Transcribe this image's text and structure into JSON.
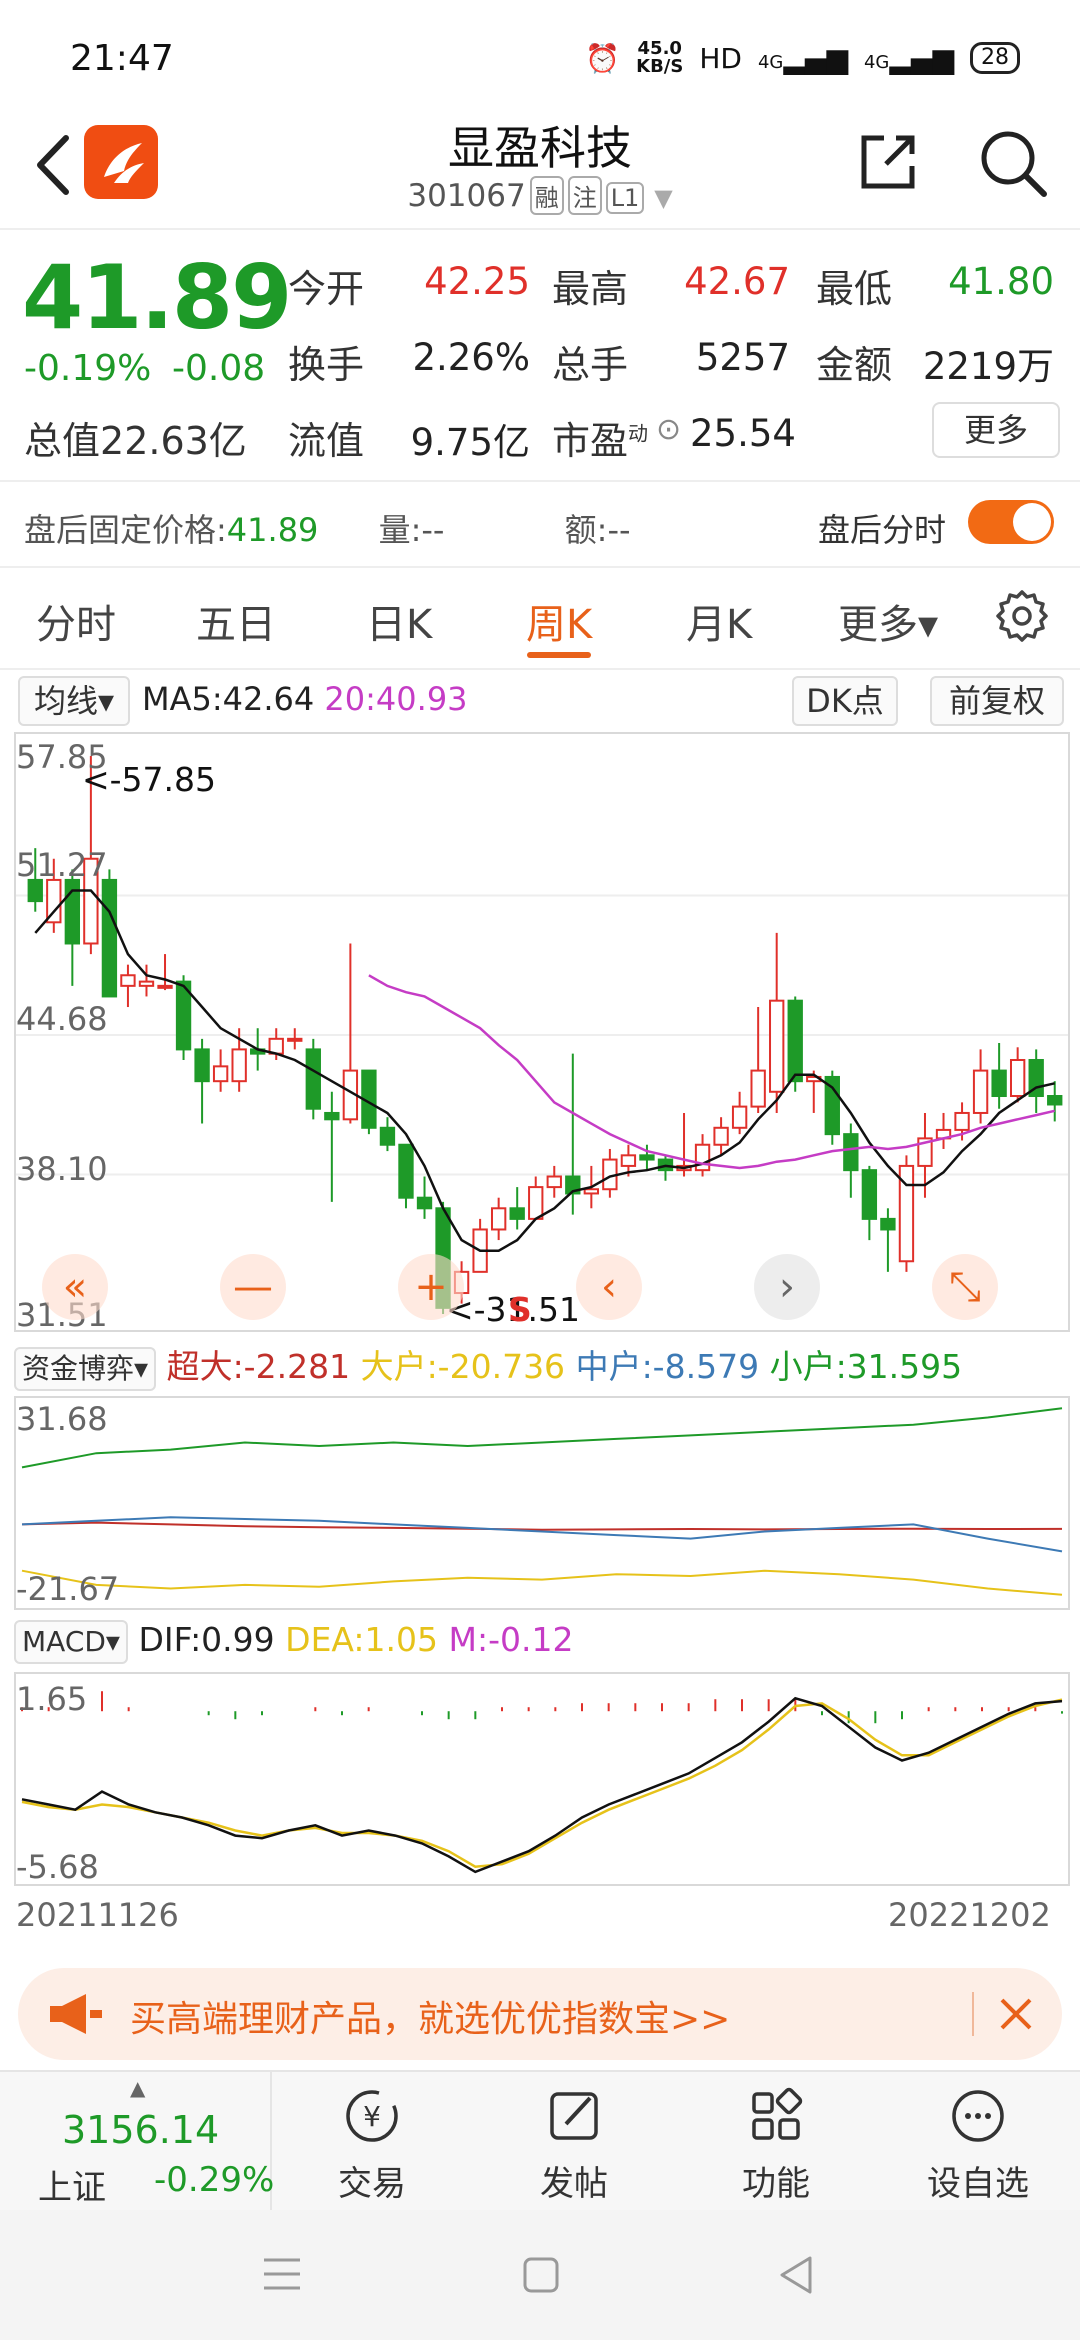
{
  "status": {
    "time": "21:47",
    "net_speed": "45.0",
    "net_unit": "KB/S",
    "hd": "HD",
    "sig1": "4G",
    "sig2": "4G",
    "battery": "28"
  },
  "header": {
    "title": "显盈科技",
    "code": "301067",
    "tags": [
      "融",
      "注",
      "L1"
    ]
  },
  "quote": {
    "price": "41.89",
    "change_pct": "-0.19%",
    "change_abs": "-0.08",
    "open_label": "今开",
    "open": "42.25",
    "high_label": "最高",
    "high": "42.67",
    "low_label": "最低",
    "low": "41.80",
    "turnover_label": "换手",
    "turnover": "2.26%",
    "volume_label": "总手",
    "volume": "5257",
    "amount_label": "金额",
    "amount": "2219万",
    "total_label": "总值",
    "total": "22.63亿",
    "float_label": "流值",
    "float": "9.75亿",
    "pe_label": "市盈",
    "pe_sup": "动",
    "pe": "25.54",
    "more": "更多"
  },
  "after_hours": {
    "label": "盘后固定价格:",
    "price": "41.89",
    "vol_label": "量:",
    "vol": "--",
    "amt_label": "额:",
    "amt": "--",
    "timeshare": "盘后分时"
  },
  "tabs": [
    "分时",
    "五日",
    "日K",
    "周K",
    "月K",
    "更多▾"
  ],
  "ma": {
    "selector": "均线▾",
    "ma5": "MA5:42.64",
    "ma20": "20:40.93",
    "dk": "DK点",
    "fq": "前复权"
  },
  "kline": {
    "y_labels": [
      "57.85",
      "51.27",
      "44.68",
      "38.10",
      "31.51"
    ],
    "max_annot": "<-57.85",
    "min_annot": "<-31.51",
    "s_marker": "S",
    "controls": [
      "«",
      "—",
      "+",
      "‹",
      "›",
      "⤡"
    ]
  },
  "fund": {
    "selector": "资金博弈▾",
    "super": "超大:-2.281",
    "big": "大户:-20.736",
    "mid": "中户:-8.579",
    "small": "小户:31.595",
    "y_top": "31.68",
    "y_bottom": "-21.67"
  },
  "macd": {
    "selector": "MACD▾",
    "dif": "DIF:0.99",
    "dea": "DEA:1.05",
    "m": "M:-0.12",
    "y_top": "1.65",
    "y_bottom": "-5.68"
  },
  "dates": {
    "start": "20211126",
    "end": "20221202"
  },
  "ad": {
    "text": "买高端理财产品，就选优优指数宝>>"
  },
  "bottom": {
    "index_value": "3156.14",
    "index_name": "上证",
    "index_change": "-0.29%",
    "items": [
      "交易",
      "发帖",
      "功能",
      "设自选"
    ]
  },
  "colors": {
    "red": "#e0302a",
    "green": "#1e9a28",
    "accent": "#e8611a",
    "yellow": "#e6c21a",
    "blue": "#3d7ab5",
    "magenta": "#c53cc5"
  },
  "chart_data": {
    "type": "candlestick",
    "x_range": [
      "20211126",
      "20221202"
    ],
    "ylim": [
      31.51,
      57.85
    ],
    "candles": [
      [
        52,
        51,
        53.5,
        50.5
      ],
      [
        50,
        52,
        53,
        49.5
      ],
      [
        52,
        49,
        52.5,
        47
      ],
      [
        49,
        53,
        57.85,
        48.5
      ],
      [
        52,
        46.5,
        52.5,
        46.5
      ],
      [
        47,
        47.5,
        48,
        46
      ],
      [
        47,
        47.2,
        48,
        46.5
      ],
      [
        47,
        47,
        48.5,
        46.8
      ],
      [
        47.2,
        44,
        47.5,
        43.5
      ],
      [
        44,
        42.5,
        44.5,
        40.5
      ],
      [
        42.5,
        43.2,
        44,
        42
      ],
      [
        42.5,
        44,
        45,
        42
      ],
      [
        44,
        43.8,
        45,
        43
      ],
      [
        43.8,
        44.5,
        45,
        43.5
      ],
      [
        44.5,
        44.5,
        45,
        44
      ],
      [
        44,
        41.2,
        44.5,
        40.7
      ],
      [
        41,
        40.7,
        42,
        36.8
      ],
      [
        40.7,
        43,
        49,
        40.5
      ],
      [
        43,
        40.3,
        43,
        40
      ],
      [
        40.3,
        39.5,
        40.8,
        39.2
      ],
      [
        39.5,
        37,
        39.5,
        36.5
      ],
      [
        37,
        36.5,
        38,
        36
      ],
      [
        36.5,
        31.8,
        36.8,
        31.51
      ],
      [
        32.5,
        33.5,
        34,
        32
      ],
      [
        33.5,
        35.5,
        36,
        33.5
      ],
      [
        35.5,
        36.5,
        37,
        35
      ],
      [
        36.5,
        36,
        37.5,
        35.5
      ],
      [
        36,
        37.5,
        38,
        36
      ],
      [
        37.5,
        38,
        38.5,
        37
      ],
      [
        38,
        37.2,
        43.8,
        36.2
      ],
      [
        37.2,
        37.4,
        38.5,
        36.5
      ],
      [
        37.4,
        38.8,
        39.3,
        37
      ],
      [
        38.5,
        39,
        39.5,
        38
      ],
      [
        39,
        38.8,
        39.5,
        38.3
      ],
      [
        38.8,
        38.3,
        39,
        37.8
      ],
      [
        38.3,
        38.5,
        41,
        38
      ],
      [
        38.3,
        39.5,
        40,
        38
      ],
      [
        39.5,
        40.3,
        40.8,
        39
      ],
      [
        40.3,
        41.3,
        42,
        40
      ],
      [
        41.3,
        43,
        46,
        41
      ],
      [
        42,
        46.3,
        49.5,
        41
      ],
      [
        46.3,
        42.5,
        46.5,
        42
      ],
      [
        42.5,
        42.7,
        43,
        41
      ],
      [
        42.7,
        40,
        43,
        39.5
      ],
      [
        40,
        38.3,
        40.5,
        37
      ],
      [
        38.3,
        36,
        38.5,
        35
      ],
      [
        36,
        35.5,
        36.5,
        33.5
      ],
      [
        34,
        38.5,
        39,
        33.5
      ],
      [
        38.5,
        39.8,
        41,
        37
      ],
      [
        39.8,
        40.2,
        41,
        39.3
      ],
      [
        40.2,
        41,
        41.5,
        39.7
      ],
      [
        41,
        43,
        44,
        40.5
      ],
      [
        43,
        41.8,
        44.3,
        41.2
      ],
      [
        41.8,
        43.5,
        44.1,
        41.5
      ],
      [
        43.5,
        41.8,
        44,
        41
      ],
      [
        41.8,
        41.4,
        42.5,
        40.6
      ]
    ],
    "ma5": [
      49.5,
      50.5,
      51.5,
      51.5,
      50.5,
      48.5,
      47.5,
      47.3,
      47,
      46,
      45,
      44.5,
      44,
      43.8,
      43.5,
      43,
      42.5,
      42,
      41.5,
      41,
      40,
      38.5,
      36.5,
      35,
      34.5,
      34.5,
      35,
      36,
      36.5,
      37.3,
      37.5,
      38,
      38.2,
      38.3,
      38.5,
      38.4,
      38.6,
      39,
      39.6,
      40.7,
      41.6,
      42.8,
      42.8,
      42.2,
      41,
      39.6,
      38.5,
      37.6,
      37.6,
      38.2,
      39.2,
      40,
      41,
      41.6,
      42.2,
      42.4
    ],
    "ma20_start_index": 18,
    "ma20": [
      47.5,
      47,
      46.7,
      46.5,
      46,
      45.5,
      45,
      44.2,
      43.5,
      42.5,
      41.5,
      41,
      40.5,
      40,
      39.6,
      39.2,
      39,
      38.8,
      38.6,
      38.5,
      38.4,
      38.5,
      38.7,
      38.8,
      39,
      39.2,
      39.3,
      39.4,
      39.3,
      39.4,
      39.6,
      39.8,
      40,
      40.3,
      40.5,
      40.7,
      40.9,
      41.1
    ],
    "fund_series": [
      {
        "name": "超大",
        "values": [
          -1,
          -0.5,
          -1,
          -1.5,
          -1.8,
          -2,
          -2.2,
          -2.5,
          -2.4,
          -2.3,
          -2.4,
          -2.3,
          -2.2,
          -2.3,
          -2.281
        ]
      },
      {
        "name": "大户",
        "values": [
          -14,
          -18,
          -19,
          -18,
          -18.5,
          -17,
          -16,
          -16.5,
          -15,
          -15.5,
          -14,
          -15,
          -16.5,
          -19,
          -20.736
        ]
      },
      {
        "name": "中户",
        "values": [
          -1,
          0,
          1,
          0.5,
          0,
          -1,
          -2,
          -3,
          -4,
          -5,
          -3,
          -2,
          -1,
          -5,
          -8.579
        ]
      },
      {
        "name": "小户",
        "values": [
          15,
          19,
          20,
          22,
          21,
          22,
          21,
          22,
          23,
          24,
          25,
          26,
          27,
          29,
          31.595
        ]
      }
    ],
    "macd_dif": [
      -2.8,
      -3,
      -3.2,
      -2.5,
      -3,
      -3.3,
      -3.5,
      -3.8,
      -4.2,
      -4.3,
      -4,
      -3.8,
      -4.2,
      -4,
      -4.2,
      -4.5,
      -5,
      -5.6,
      -5.2,
      -4.8,
      -4.2,
      -3.5,
      -3,
      -2.6,
      -2.2,
      -1.8,
      -1.2,
      -0.6,
      0.2,
      1.1,
      0.8,
      0,
      -0.8,
      -1.3,
      -1,
      -0.5,
      0,
      0.5,
      0.9,
      0.99
    ],
    "macd_dea": [
      -2.9,
      -3.1,
      -3.2,
      -3,
      -3.1,
      -3.3,
      -3.5,
      -3.7,
      -4,
      -4.2,
      -4,
      -3.9,
      -4.1,
      -4.1,
      -4.2,
      -4.4,
      -4.8,
      -5.4,
      -5.3,
      -4.9,
      -4.3,
      -3.7,
      -3.2,
      -2.8,
      -2.4,
      -2,
      -1.5,
      -0.9,
      -0.1,
      0.8,
      0.9,
      0.3,
      -0.5,
      -1.1,
      -1.1,
      -0.6,
      -0.1,
      0.4,
      0.8,
      1.05
    ]
  }
}
